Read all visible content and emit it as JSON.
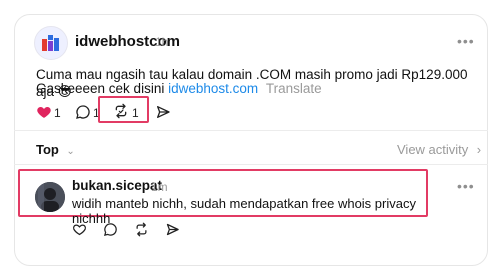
{
  "post": {
    "username": "idwebhostcom",
    "time": "1h",
    "more": "•••",
    "text_line1": "Cuma mau ngasih tau kalau domain .COM masih promo jadi Rp129.000 aja 😎",
    "text_line2_prefix": "Gaskeeeen cek disini",
    "link": "idwebhost.com",
    "translate": "Translate",
    "likes": "1",
    "replies": "1",
    "reposts": "1",
    "like_color": "#e0245e"
  },
  "thread": {
    "sort_label": "Top",
    "view_activity": "View activity"
  },
  "reply": {
    "username": "bukan.sicepat",
    "time": "1m",
    "more": "•••",
    "text": "widih manteb nichh, sudah mendapatkan free whois privacy nichhh"
  },
  "highlight_color": "#e23b64"
}
